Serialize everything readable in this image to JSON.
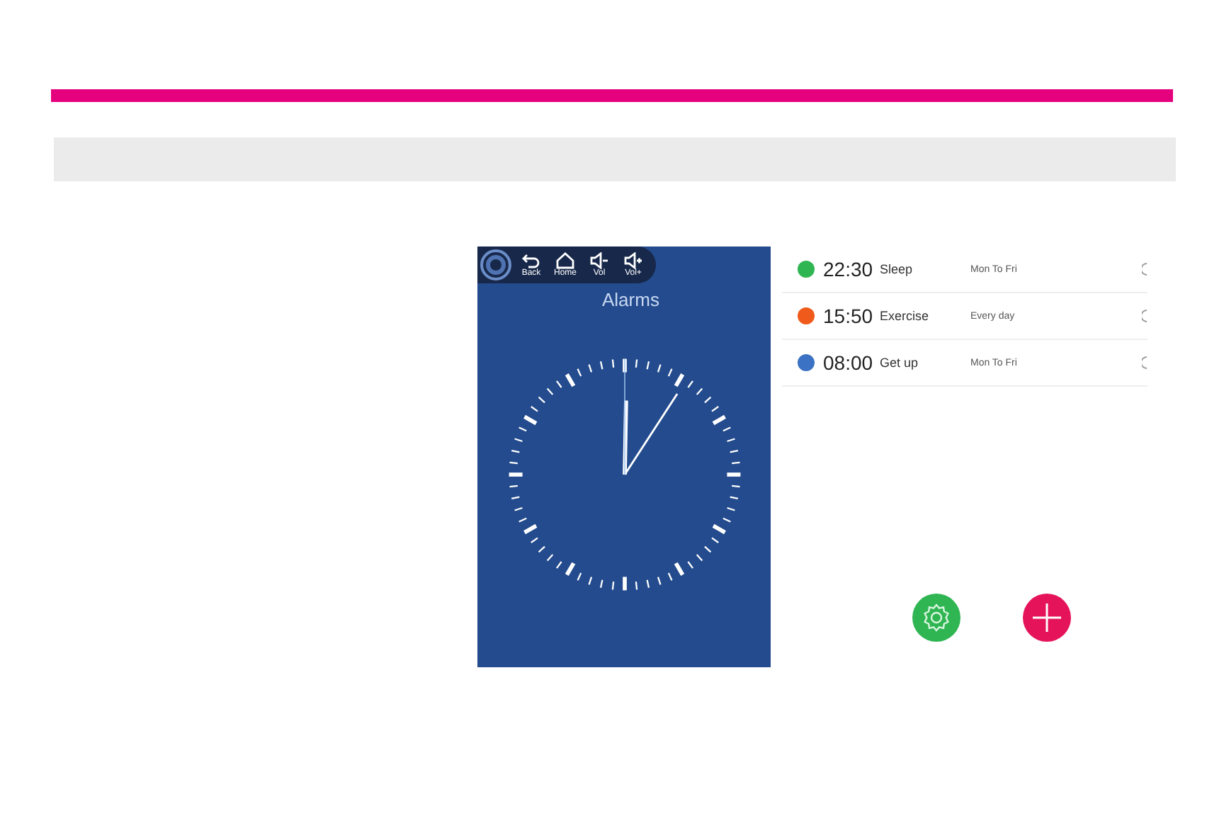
{
  "phone": {
    "title": "Alarms",
    "nav_buttons": [
      {
        "label": "Back",
        "kind": "back"
      },
      {
        "label": "Home",
        "kind": "home"
      },
      {
        "label": "Vol",
        "kind": "vol_down"
      },
      {
        "label": "Vol+",
        "kind": "vol_up"
      }
    ]
  },
  "alarms": [
    {
      "time": "22:30",
      "name": "Sleep",
      "repeat": "Mon To Fri",
      "color": "#2fb552"
    },
    {
      "time": "15:50",
      "name": "Exercise",
      "repeat": "Every day",
      "color": "#f05a1a"
    },
    {
      "time": "08:00",
      "name": "Get up",
      "repeat": "Mon To Fri",
      "color": "#3b72c4"
    }
  ]
}
